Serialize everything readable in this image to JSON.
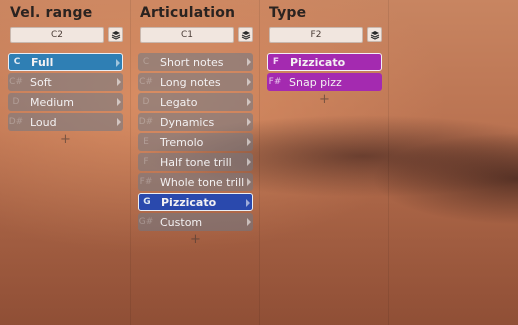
{
  "columns": [
    {
      "title": "Vel. range",
      "key_value": "C2",
      "items": [
        {
          "key": "C",
          "label": "Full",
          "style": "blue-sel"
        },
        {
          "key": "C#",
          "label": "Soft",
          "style": ""
        },
        {
          "key": "D",
          "label": "Medium",
          "style": ""
        },
        {
          "key": "D#",
          "label": "Loud",
          "style": ""
        }
      ],
      "add_label": "+"
    },
    {
      "title": "Articulation",
      "key_value": "C1",
      "items": [
        {
          "key": "C",
          "label": "Short notes",
          "style": ""
        },
        {
          "key": "C#",
          "label": "Long notes",
          "style": ""
        },
        {
          "key": "D",
          "label": "Legato",
          "style": ""
        },
        {
          "key": "D#",
          "label": "Dynamics",
          "style": ""
        },
        {
          "key": "E",
          "label": "Tremolo",
          "style": ""
        },
        {
          "key": "F",
          "label": "Half tone trill",
          "style": ""
        },
        {
          "key": "F#",
          "label": "Whole tone trill",
          "style": ""
        },
        {
          "key": "G",
          "label": "Pizzicato",
          "style": "pizz-sel"
        },
        {
          "key": "G#",
          "label": "Custom",
          "style": ""
        }
      ],
      "add_label": "+"
    },
    {
      "title": "Type",
      "key_value": "F2",
      "items": [
        {
          "key": "F",
          "label": "Pizzicato",
          "style": "purple-sel"
        },
        {
          "key": "F#",
          "label": "Snap pizz",
          "style": "purple"
        }
      ],
      "add_label": "+"
    }
  ]
}
